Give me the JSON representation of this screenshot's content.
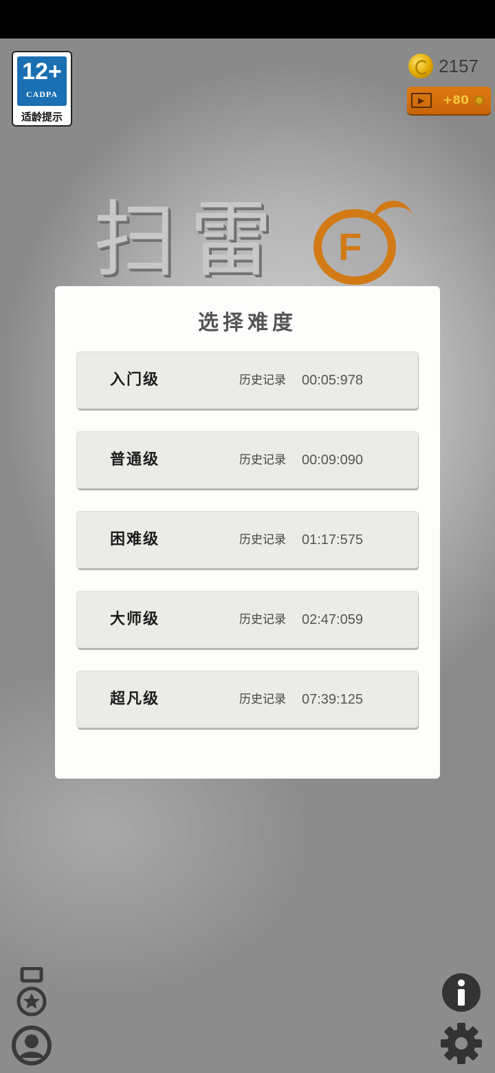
{
  "age_badge": {
    "rating": "12+",
    "org": "CADPA",
    "caption": "适龄提示"
  },
  "currency": {
    "coins": "2157",
    "ad_reward": "+80"
  },
  "game": {
    "title": "扫雷",
    "logo_letter": "F"
  },
  "dialog": {
    "title": "选择难度",
    "levels": [
      {
        "name": "入门级",
        "record_label": "历史记录",
        "record_time": "00:05:978"
      },
      {
        "name": "普通级",
        "record_label": "历史记录",
        "record_time": "00:09:090"
      },
      {
        "name": "困难级",
        "record_label": "历史记录",
        "record_time": "01:17:575"
      },
      {
        "name": "大师级",
        "record_label": "历史记录",
        "record_time": "02:47:059"
      },
      {
        "name": "超凡级",
        "record_label": "历史记录",
        "record_time": "07:39:125"
      }
    ]
  },
  "icons": {
    "medal": "medal-icon",
    "profile": "profile-icon",
    "info": "info-icon",
    "settings": "gear-icon",
    "coin": "coin-icon",
    "video_ad": "film-icon"
  },
  "colors": {
    "accent_orange": "#d27a16",
    "badge_blue": "#1b6fb3",
    "dialog_bg": "#fdfdfb",
    "button_bg": "#ebebe8"
  }
}
